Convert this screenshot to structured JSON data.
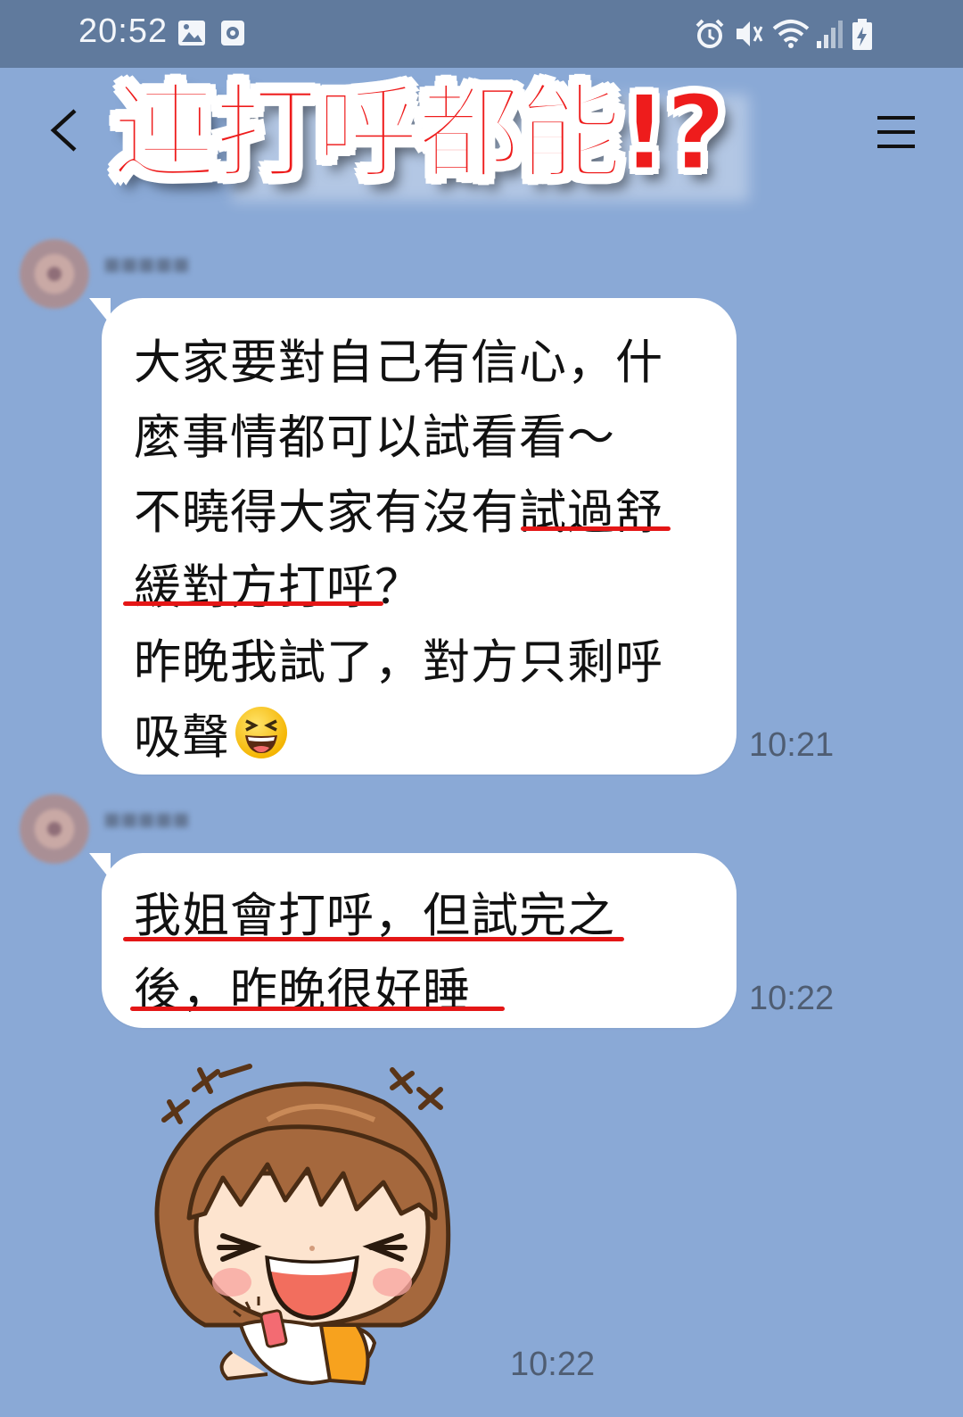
{
  "status_bar": {
    "time": "20:52",
    "left_icons": [
      "image-icon",
      "screen-record-icon"
    ],
    "right_icons": [
      "alarm-icon",
      "mute-icon",
      "wifi-icon",
      "signal-icon",
      "battery-charging-icon"
    ]
  },
  "header": {
    "caption": "連打呼都能!?",
    "caption_color": "#ee1c1c"
  },
  "messages": [
    {
      "lines": [
        "大家要對自己有信心，什",
        "麼事情都可以試看看～",
        "不曉得大家有沒有試過舒",
        "緩對方打呼？",
        "昨晚我試了，對方只剩呼",
        "吸聲"
      ],
      "emoji": "laughing-face",
      "time": "10:21"
    },
    {
      "lines": [
        "我姐會打呼，但試完之",
        "後，昨晚很好睡"
      ],
      "time": "10:22"
    },
    {
      "sticker": "laughing-girl-sticker",
      "time": "10:22"
    }
  ],
  "colors": {
    "chat_background": "#8aa9d6",
    "status_bar": "#607a9d",
    "highlight_underline": "#e41616"
  }
}
